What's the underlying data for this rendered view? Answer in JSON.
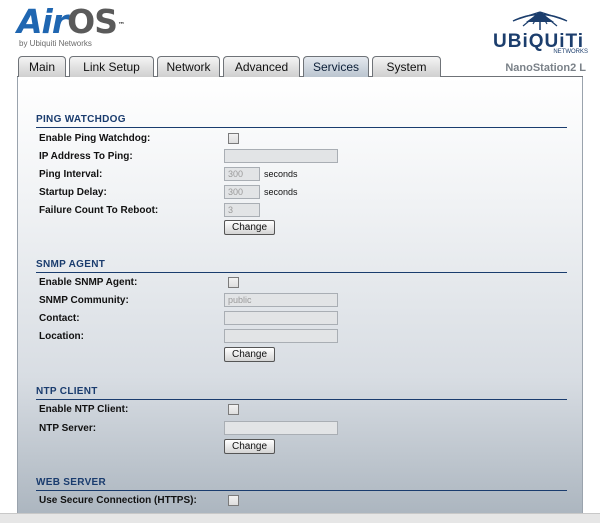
{
  "header": {
    "logo_air": "Air",
    "logo_os": "OS",
    "logo_tm": "™",
    "logo_sub": "by Ubiquiti Networks",
    "brand": "UBiQUiTi",
    "brand_sub": "NETWORKS",
    "device_name": "NanoStation2 L"
  },
  "tabs": [
    {
      "label": "Main",
      "active": false
    },
    {
      "label": "Link Setup",
      "active": false
    },
    {
      "label": "Network",
      "active": false
    },
    {
      "label": "Advanced",
      "active": false
    },
    {
      "label": "Services",
      "active": true
    },
    {
      "label": "System",
      "active": false
    }
  ],
  "ping_watchdog": {
    "title": "PING WATCHDOG",
    "enable_label": "Enable Ping Watchdog:",
    "enable_checked": false,
    "ip_label": "IP Address To Ping:",
    "ip_value": "",
    "interval_label": "Ping Interval:",
    "interval_value": "300",
    "interval_unit": "seconds",
    "delay_label": "Startup Delay:",
    "delay_value": "300",
    "delay_unit": "seconds",
    "failure_label": "Failure Count To Reboot:",
    "failure_value": "3",
    "change_label": "Change"
  },
  "snmp_agent": {
    "title": "SNMP AGENT",
    "enable_label": "Enable SNMP Agent:",
    "enable_checked": false,
    "community_label": "SNMP Community:",
    "community_value": "public",
    "contact_label": "Contact:",
    "contact_value": "",
    "location_label": "Location:",
    "location_value": "",
    "change_label": "Change"
  },
  "ntp_client": {
    "title": "NTP CLIENT",
    "enable_label": "Enable NTP Client:",
    "enable_checked": false,
    "server_label": "NTP Server:",
    "server_value": "",
    "change_label": "Change"
  },
  "web_server": {
    "title": "WEB SERVER",
    "https_label": "Use Secure Connection (HTTPS):",
    "https_checked": false
  },
  "colors": {
    "section_title": "#1a3c6e",
    "logo_air": "#1f66b1",
    "brand": "#1c3e6d"
  }
}
